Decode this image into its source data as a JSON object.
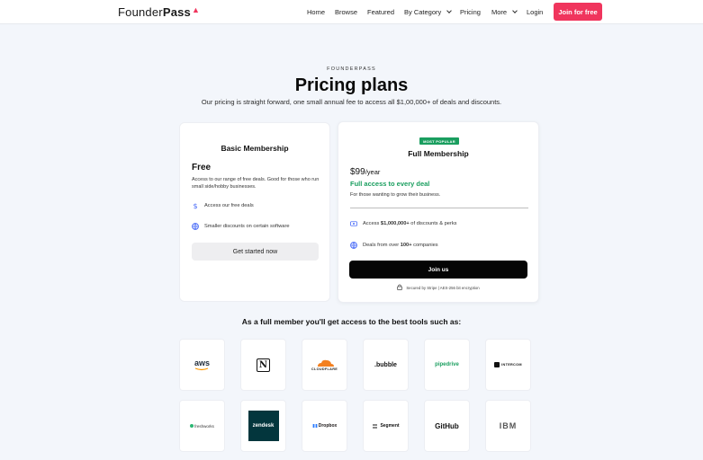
{
  "brand": {
    "name_regular": "Founder",
    "name_bold": "Pass",
    "flame": "🔥",
    "accent": "#f0355d"
  },
  "nav": {
    "items": [
      {
        "label": "Home"
      },
      {
        "label": "Browse"
      },
      {
        "label": "Featured"
      },
      {
        "label": "By Category",
        "dropdown": true
      },
      {
        "label": "Pricing"
      },
      {
        "label": "More",
        "dropdown": true
      },
      {
        "label": "Login"
      }
    ],
    "cta": "Join for free"
  },
  "hero": {
    "eyebrow": "FOUNDERPASS",
    "title": "Pricing plans",
    "subtitle": "Our pricing is straight forward, one small annual fee to access all $1,00,000+ of deals and discounts."
  },
  "basic": {
    "title": "Basic Membership",
    "price": "Free",
    "description": "Access to our range of free deals. Good for those who run small side/hobby businesses.",
    "features": [
      {
        "icon": "dollar-icon",
        "text": "Access our free deals"
      },
      {
        "icon": "globe-icon",
        "text": "Smaller discounts on certain software"
      }
    ],
    "cta": "Get started now"
  },
  "full": {
    "badge": "MOST POPULAR",
    "title": "Full Membership",
    "price": "$99",
    "period": "/year",
    "access": "Full access to every deal",
    "description": "For those wanting to grow their business.",
    "features": [
      {
        "icon": "deals-icon",
        "text_pre": "Access ",
        "text_bold": "$1,000,000+",
        "text_post": " of discounts & perks"
      },
      {
        "icon": "globe-icon",
        "text_pre": "Deals from over ",
        "text_bold": "100+",
        "text_post": " companies"
      }
    ],
    "cta": "Join us",
    "secure": "Secured by Stripe | AES-256 bit encryption",
    "accent": "#1a9e5f"
  },
  "tools": {
    "title": "As a full member you'll get access to the best tools such as:",
    "row1": [
      "aws",
      "notion",
      "CLOUDFLARE",
      ".bubble",
      "pipedrive",
      "INTERCOM"
    ],
    "row2": [
      "freshworks",
      "zendesk",
      "Dropbox",
      "Segment",
      "GitHub",
      "IBM"
    ]
  }
}
